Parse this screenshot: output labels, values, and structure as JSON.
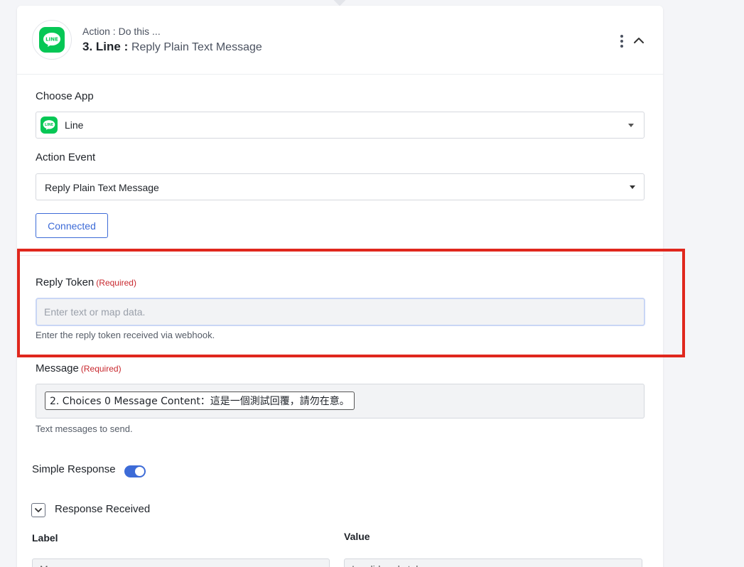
{
  "header": {
    "subtitle": "Action : Do this ...",
    "step_app": "3. Line :",
    "step_event": "Reply Plain Text Message"
  },
  "app_logo_text": "LINE",
  "choose_app": {
    "label": "Choose App",
    "value": "Line"
  },
  "action_event": {
    "label": "Action Event",
    "value": "Reply Plain Text Message"
  },
  "connection": {
    "button_label": "Connected"
  },
  "reply_token": {
    "label": "Reply Token",
    "required": "(Required)",
    "placeholder": "Enter text or map data.",
    "help": "Enter the reply token received via webhook."
  },
  "message": {
    "label": "Message",
    "required": "(Required)",
    "chip": "2. Choices 0 Message Content：這是一個測試回覆，請勿在意。",
    "help": "Text messages to send."
  },
  "simple_response": {
    "label": "Simple Response",
    "enabled": true
  },
  "response_received": {
    "label": "Response Received",
    "checked": true
  },
  "response_table": {
    "label_header": "Label",
    "value_header": "Value",
    "row_label": "M",
    "row_value": "Invalid reply token"
  },
  "colors": {
    "accent": "#3d6bd7",
    "line_green": "#06c755",
    "required_red": "#c8282e",
    "highlight_red": "#e0271d"
  }
}
